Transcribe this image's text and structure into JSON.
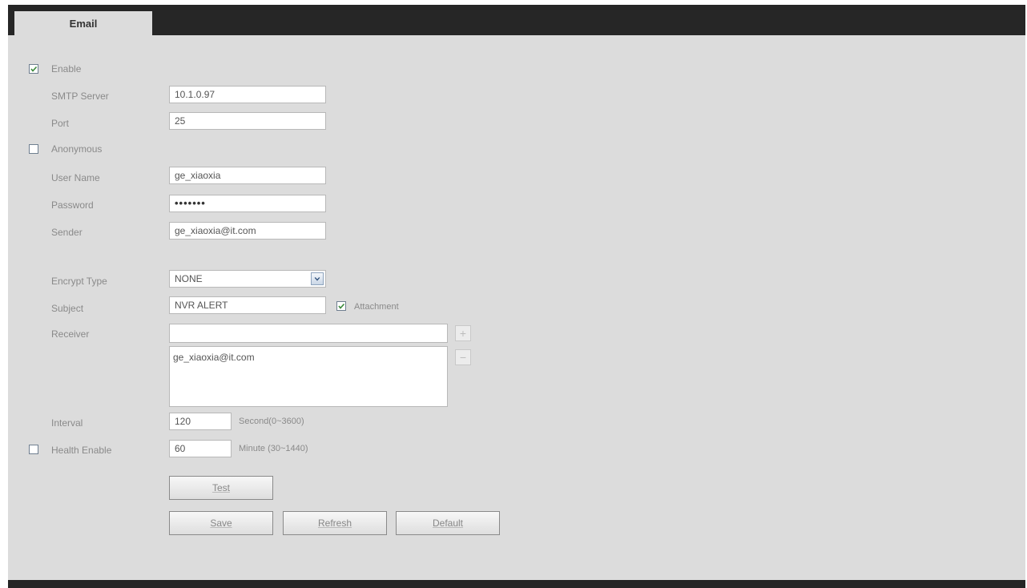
{
  "tab": {
    "label": "Email"
  },
  "enable": {
    "label": "Enable",
    "checked": true
  },
  "smtp_server": {
    "label": "SMTP Server",
    "value": "10.1.0.97"
  },
  "port": {
    "label": "Port",
    "value": "25"
  },
  "anonymous": {
    "label": "Anonymous",
    "checked": false
  },
  "user_name": {
    "label": "User Name",
    "value": "ge_xiaoxia"
  },
  "password": {
    "label": "Password",
    "masked": "•••••••"
  },
  "sender": {
    "label": "Sender",
    "value": "ge_xiaoxia@it.com"
  },
  "encrypt_type": {
    "label": "Encrypt Type",
    "value": "NONE"
  },
  "subject": {
    "label": "Subject",
    "value": "NVR ALERT"
  },
  "attachment": {
    "label": "Attachment",
    "checked": true
  },
  "receiver": {
    "label": "Receiver",
    "input_value": "",
    "add_symbol": "+",
    "remove_symbol": "−",
    "items": [
      "ge_xiaoxia@it.com"
    ]
  },
  "interval": {
    "label": "Interval",
    "value": "120",
    "unit": "Second(0~3600)"
  },
  "health_enable": {
    "label": "Health Enable",
    "checked": false,
    "value": "60",
    "unit": "Minute (30~1440)"
  },
  "buttons": {
    "test": "Test",
    "save": "Save",
    "refresh": "Refresh",
    "default": "Default"
  },
  "colors": {
    "background": "#dcdcdc",
    "bar": "#262626",
    "checkmark": "#3a8a3a"
  }
}
